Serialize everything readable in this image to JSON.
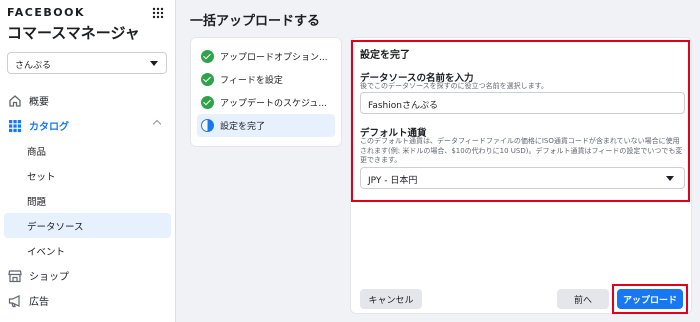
{
  "app": {
    "brand": "FACEBOOK",
    "title": "コマースマネージャ",
    "shop_selector": "さんぷる"
  },
  "sidebar": {
    "items": [
      {
        "label": "概要",
        "icon": "home-icon"
      },
      {
        "label": "カタログ",
        "icon": "grid-icon"
      },
      {
        "label": "商品"
      },
      {
        "label": "セット"
      },
      {
        "label": "問題"
      },
      {
        "label": "データソース"
      },
      {
        "label": "イベント"
      },
      {
        "label": "ショップ",
        "icon": "shop-icon"
      },
      {
        "label": "広告",
        "icon": "megaphone-icon"
      }
    ]
  },
  "page": {
    "title": "一括アップロードする"
  },
  "steps": [
    {
      "label": "アップロードオプション...",
      "status": "complete"
    },
    {
      "label": "フィードを設定",
      "status": "complete"
    },
    {
      "label": "アップデートのスケジュ...",
      "status": "complete"
    },
    {
      "label": "設定を完了",
      "status": "current"
    }
  ],
  "form": {
    "title": "設定を完了",
    "datasource_name": {
      "label": "データソースの名前を入力",
      "help": "後でこのデータソースを探すのに役立つ名前を選択します。",
      "value": "Fashionさんぷる"
    },
    "currency": {
      "label": "デフォルト通貨",
      "help": "このデフォルト通貨は、データフィードファイルの価格にISO通貨コードが含まれていない場合に使用されます(例: 米ドルの場合、$10の代わりに10 USD)。デフォルト通貨はフィードの設定でいつでも変更できます。",
      "value": "JPY - 日本円"
    }
  },
  "buttons": {
    "cancel": "キャンセル",
    "prev": "前へ",
    "upload": "アップロード"
  },
  "colors": {
    "accent": "#1877f2",
    "success": "#31a24c",
    "highlight": "#e0001b"
  }
}
